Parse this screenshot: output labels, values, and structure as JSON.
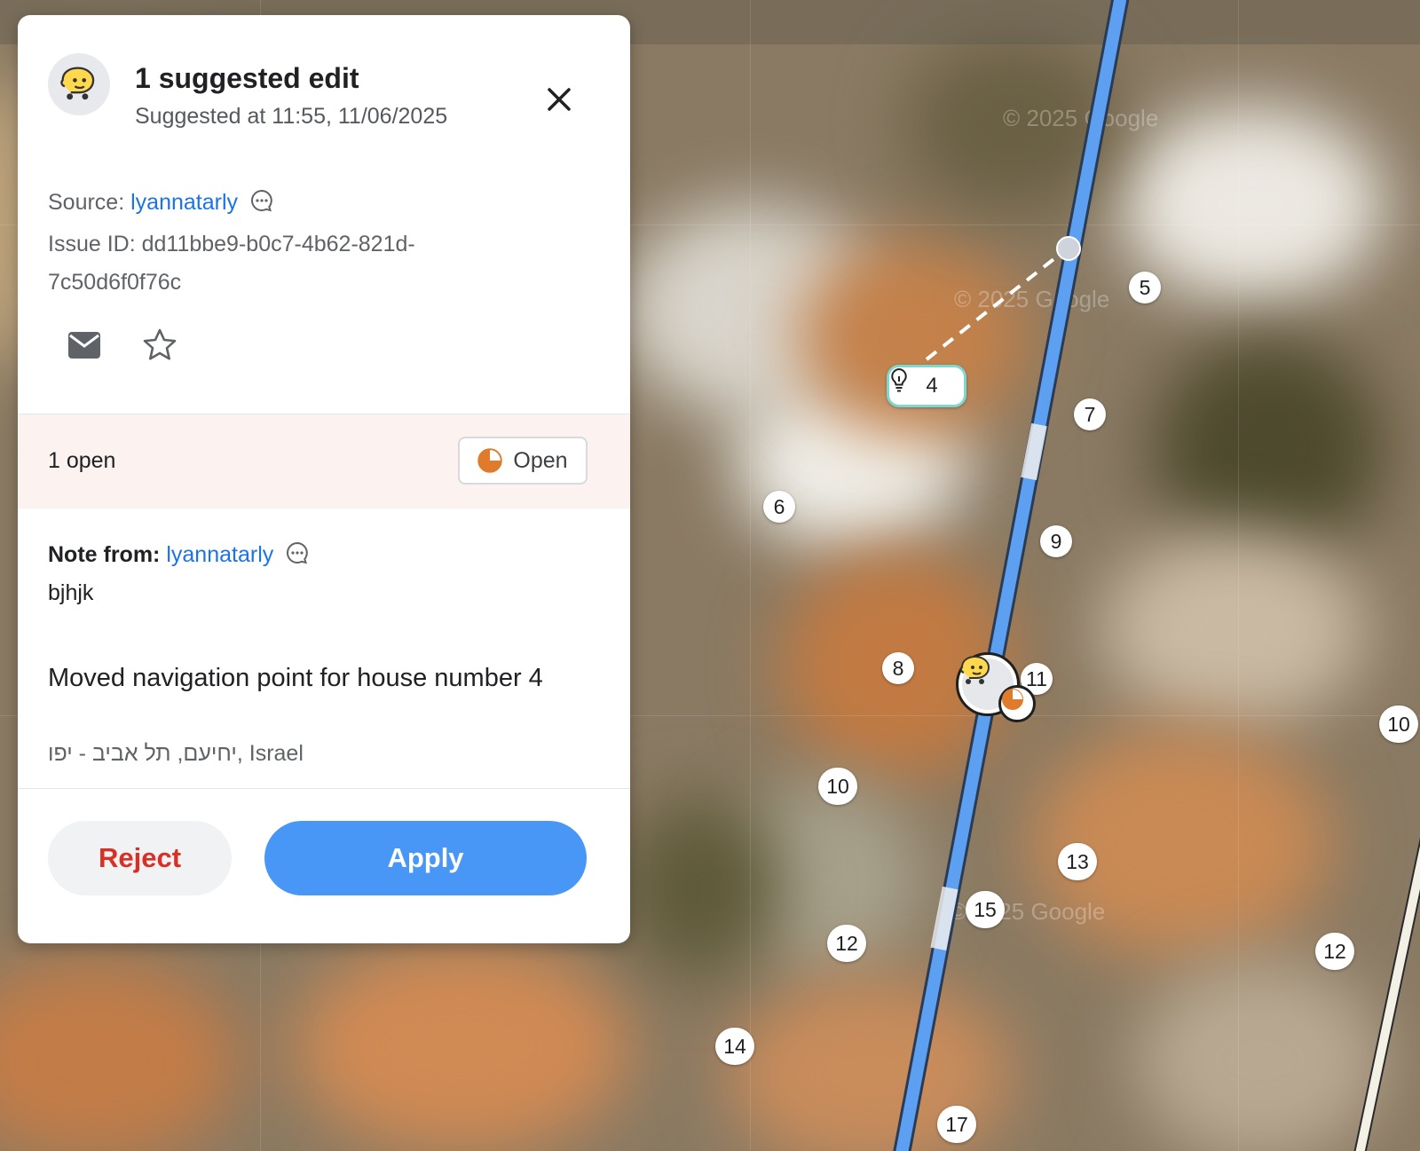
{
  "panel": {
    "title": "1 suggested edit",
    "subtitle": "Suggested at 11:55, 11/06/2025",
    "source_label": "Source:",
    "source_user": "lyannatarly",
    "issue_line1": "Issue ID: dd11bbe9-b0c7-4b62-821d-",
    "issue_line2": "7c50d6f0f76c",
    "open_count": "1 open",
    "open_button": "Open",
    "note_label": "Note from:",
    "note_user": "lyannatarly",
    "note_text": "bjhjk",
    "description": "Moved navigation point for house number 4",
    "address": "יחיעם, תל אביב - יפו, Israel",
    "reject_label": "Reject",
    "apply_label": "Apply"
  },
  "map": {
    "watermarks": [
      "© 2025 Google",
      "© 2025 Google",
      "© 2025 Google"
    ],
    "suggestion_marker_number": "4",
    "house_numbers": [
      "5",
      "7",
      "6",
      "9",
      "8",
      "11",
      "10",
      "10",
      "13",
      "15",
      "12",
      "12",
      "14",
      "17"
    ]
  },
  "colors": {
    "primary": "#4897f7",
    "reject_text": "#d93025",
    "link": "#1a73e8",
    "road": "#5d9ff0",
    "status_orange": "#e07b2c",
    "open_row_bg": "#fcf3f0"
  }
}
